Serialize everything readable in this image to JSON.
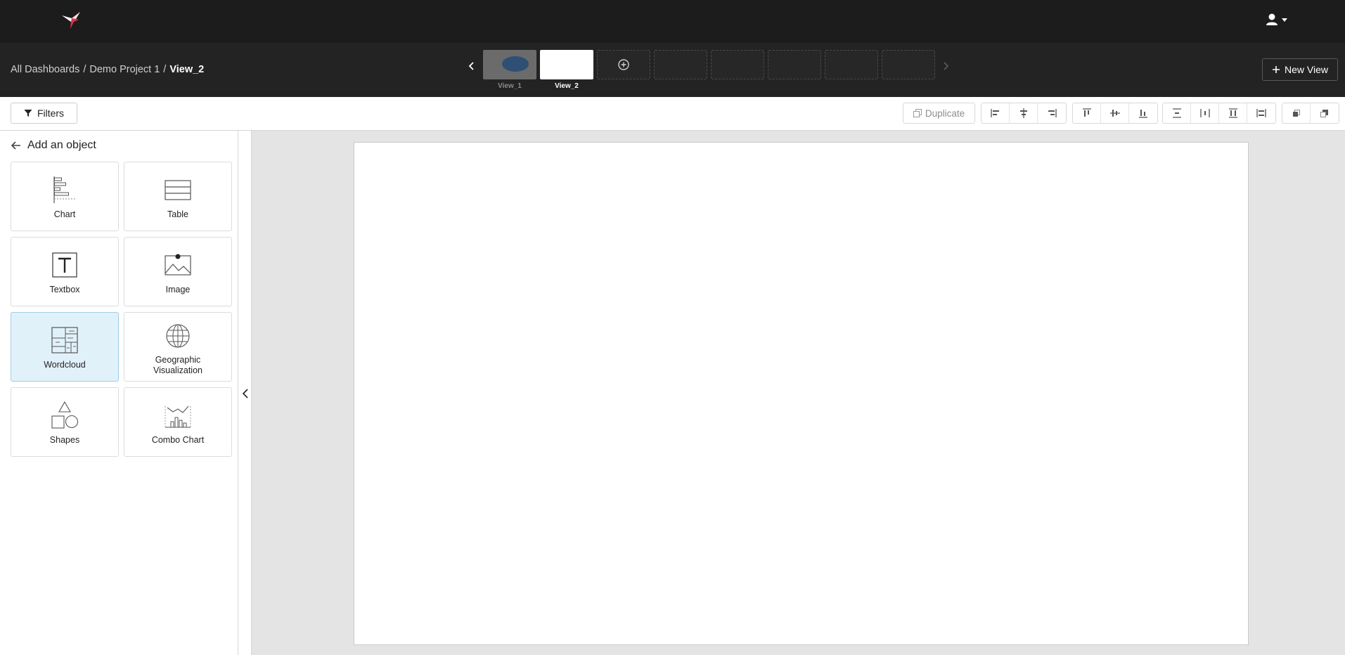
{
  "app": {
    "logo_icon": "hummingbird-logo-icon",
    "user_icon": "user-icon",
    "accent_color": "#d63447"
  },
  "breadcrumb": {
    "items": [
      "All Dashboards",
      "Demo Project 1",
      "View_2"
    ],
    "separator": "/"
  },
  "views": {
    "prev_icon": "chevron-left-icon",
    "next_icon": "chevron-right-icon",
    "add_icon": "plus-circle-icon",
    "items": [
      {
        "label": "View_1",
        "active": false
      },
      {
        "label": "View_2",
        "active": true
      }
    ],
    "new_view_label": "New View"
  },
  "toolbar": {
    "filters_label": "Filters",
    "duplicate_label": "Duplicate",
    "tool_icons": [
      "align-left-icon",
      "align-center-horizontal-icon",
      "align-right-icon",
      "align-top-icon",
      "align-middle-vertical-icon",
      "align-bottom-icon",
      "distribute-vertical-icon",
      "distribute-horizontal-icon",
      "distribute-top-icon",
      "distribute-spacing-icon",
      "bring-to-front-icon",
      "send-to-back-icon"
    ]
  },
  "panel": {
    "title": "Add an object",
    "objects": [
      {
        "label": "Chart",
        "icon": "chart-icon",
        "selected": false
      },
      {
        "label": "Table",
        "icon": "table-icon",
        "selected": false
      },
      {
        "label": "Textbox",
        "icon": "textbox-icon",
        "selected": false
      },
      {
        "label": "Image",
        "icon": "image-icon",
        "selected": false
      },
      {
        "label": "Wordcloud",
        "icon": "wordcloud-icon",
        "selected": true
      },
      {
        "label": "Geographic Visualization",
        "icon": "globe-icon",
        "selected": false
      },
      {
        "label": "Shapes",
        "icon": "shapes-icon",
        "selected": false
      },
      {
        "label": "Combo Chart",
        "icon": "combo-chart-icon",
        "selected": false
      }
    ]
  }
}
